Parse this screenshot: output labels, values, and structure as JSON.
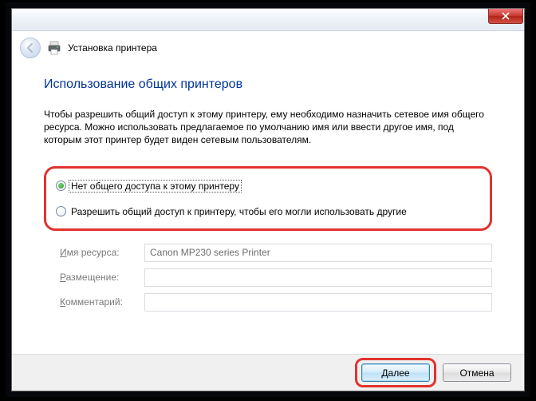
{
  "header": {
    "title": "Установка принтера"
  },
  "page": {
    "title": "Использование общих принтеров",
    "description": "Чтобы разрешить общий доступ к этому принтеру, ему необходимо назначить сетевое имя общего ресурса. Можно использовать предлагаемое по умолчанию имя или ввести другое имя, под которым этот принтер будет виден сетевым пользователям."
  },
  "options": {
    "noShare": "Нет общего доступа к этому принтеру",
    "share": "Разрешить общий доступ к принтеру, чтобы его могли использовать другие"
  },
  "form": {
    "shareNameLabelPrefix": "И",
    "shareNameLabelRest": "мя ресурса:",
    "shareNameValue": "Canon MP230 series Printer",
    "locationLabelPrefix": "Р",
    "locationLabelRest": "азмещение:",
    "locationValue": "",
    "commentLabelPrefix": "К",
    "commentLabelRest": "омментарий:",
    "commentValue": ""
  },
  "footer": {
    "next": "Далее",
    "cancel": "Отмена"
  }
}
